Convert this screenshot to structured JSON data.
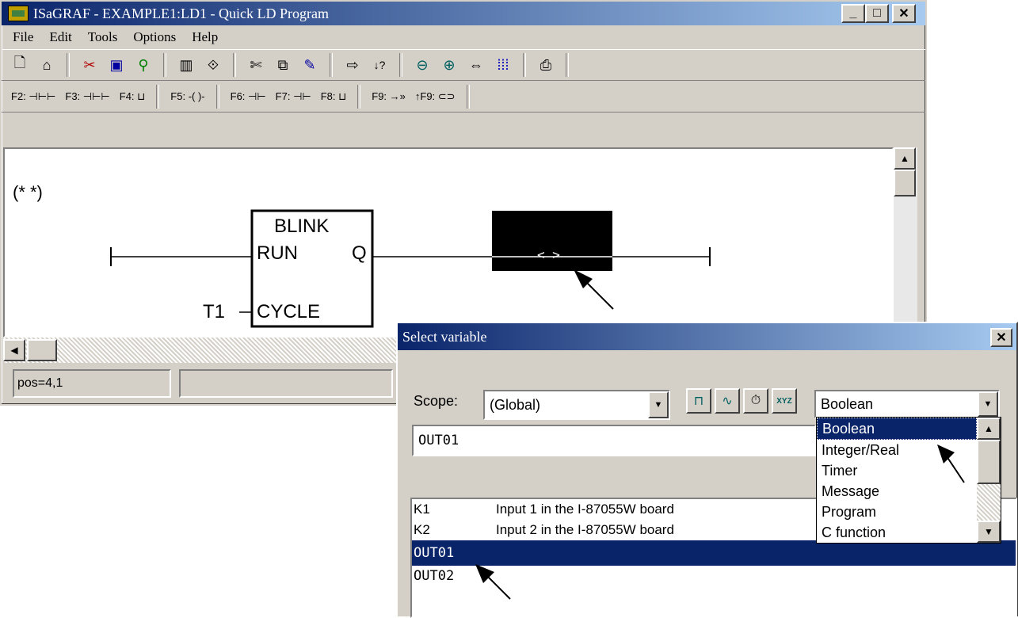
{
  "main_window": {
    "title": "ISaGRAF - EXAMPLE1:LD1 - Quick LD Program",
    "caption_buttons": {
      "minimize": "_",
      "maximize": "□",
      "close": "✕"
    },
    "menu": [
      "File",
      "Edit",
      "Tools",
      "Options",
      "Help"
    ],
    "toolbar_icons": [
      "new-doc-icon",
      "open-icon",
      "cut-icon",
      "monitor-icon",
      "search-tool-icon",
      "library-icon",
      "compile-icon",
      "scissors-icon",
      "copy-icon",
      "paste-icon",
      "exit-icon",
      "help-icon",
      "zoom-out-icon",
      "zoom-in-icon",
      "fit-icon",
      "grid-icon",
      "print-icon"
    ],
    "ld_toolbar": [
      "F2: ⊣⊢⊢",
      "F3: ⊣⊢⊢",
      "F4: ⊔",
      "F5: -( )-",
      "F6: ⊣⊢",
      "F7: ⊣⊢",
      "F8: ⊔",
      "F9: →»",
      "↑F9: ⊂⊃"
    ],
    "diagram": {
      "comment": "(*  *)",
      "block_name": "BLINK",
      "block_in_run": "RUN",
      "block_out_q": "Q",
      "block_in_cycle": "CYCLE",
      "cycle_var": "T1",
      "coil": "< >"
    },
    "status": {
      "position": "pos=4,1"
    }
  },
  "dialog": {
    "title": "Select variable",
    "close": "✕",
    "scope_label": "Scope:",
    "scope_value": "(Global)",
    "type_value": "Boolean",
    "name_value": "OUT01",
    "type_options": [
      "Boolean",
      "Integer/Real",
      "Timer",
      "Message",
      "Program",
      "C function"
    ],
    "selected_type": "Boolean",
    "variables": [
      {
        "name": "K1",
        "comment": "Input 1 in the I-87055W board"
      },
      {
        "name": "K2",
        "comment": "Input 2 in the I-87055W board"
      },
      {
        "name": "OUT01",
        "comment": ""
      },
      {
        "name": "OUT02",
        "comment": ""
      }
    ],
    "selected_variable": "OUT01"
  }
}
